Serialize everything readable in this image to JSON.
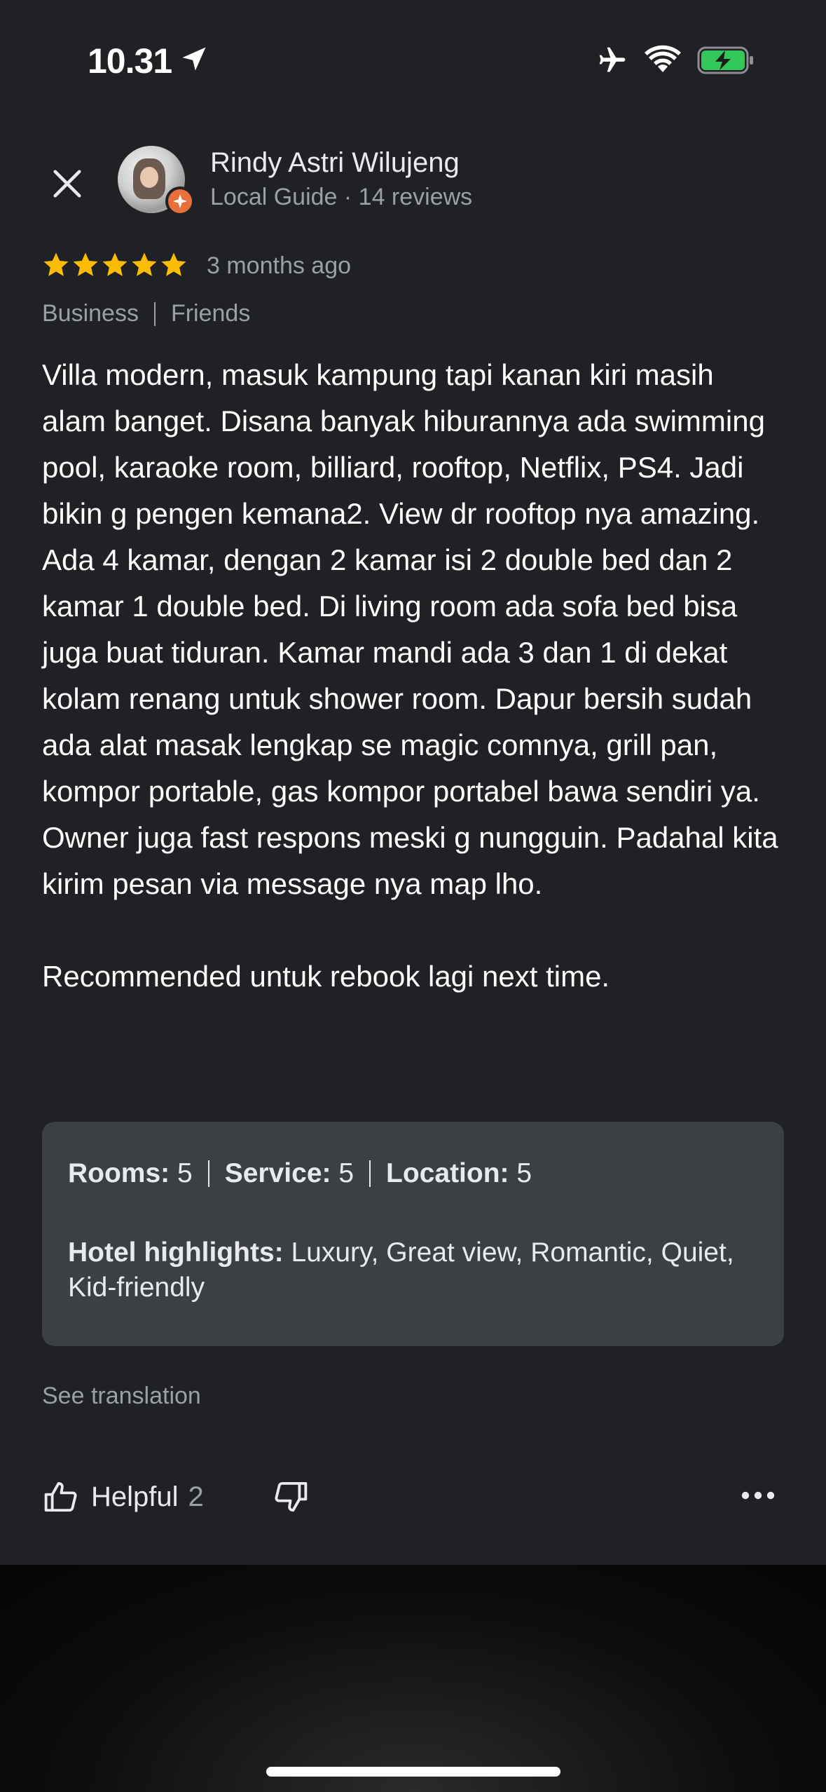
{
  "status_bar": {
    "time": "10.31",
    "icons": [
      "location-arrow-icon",
      "airplane-icon",
      "wifi-icon",
      "battery-charging-icon"
    ],
    "battery_color": "#34c759"
  },
  "reviewer": {
    "name": "Rindy Astri Wilujeng",
    "meta": "Local Guide · 14 reviews",
    "badge_color": "#e8703a"
  },
  "review": {
    "stars": 5,
    "star_color": "#fbbc04",
    "date": "3 months ago",
    "tags": [
      "Business",
      "Friends"
    ],
    "text": "Villa modern, masuk kampung tapi kanan kiri masih alam banget. Disana banyak hiburannya ada swimming pool, karaoke room, billiard, rooftop, Netflix, PS4. Jadi bikin g pengen kemana2. View dr rooftop nya amazing. Ada 4 kamar, dengan 2 kamar isi 2 double bed dan 2 kamar 1 double bed. Di living room ada sofa bed bisa juga buat tiduran. Kamar mandi ada 3 dan 1 di dekat kolam renang untuk shower room. Dapur bersih sudah ada alat masak lengkap se magic comnya, grill pan, kompor portable, gas kompor portabel bawa sendiri ya. Owner juga fast respons meski g nungguin. Padahal kita kirim pesan via message nya map lho.\n\nRecommended untuk rebook lagi next time."
  },
  "ratings": {
    "rooms_label": "Rooms:",
    "rooms_value": "5",
    "service_label": "Service:",
    "service_value": "5",
    "location_label": "Location:",
    "location_value": "5",
    "highlights_label": "Hotel highlights:",
    "highlights_value": "Luxury, Great view, Romantic, Quiet, Kid-friendly"
  },
  "actions": {
    "see_translation": "See translation",
    "helpful_label": "Helpful",
    "helpful_count": "2"
  }
}
